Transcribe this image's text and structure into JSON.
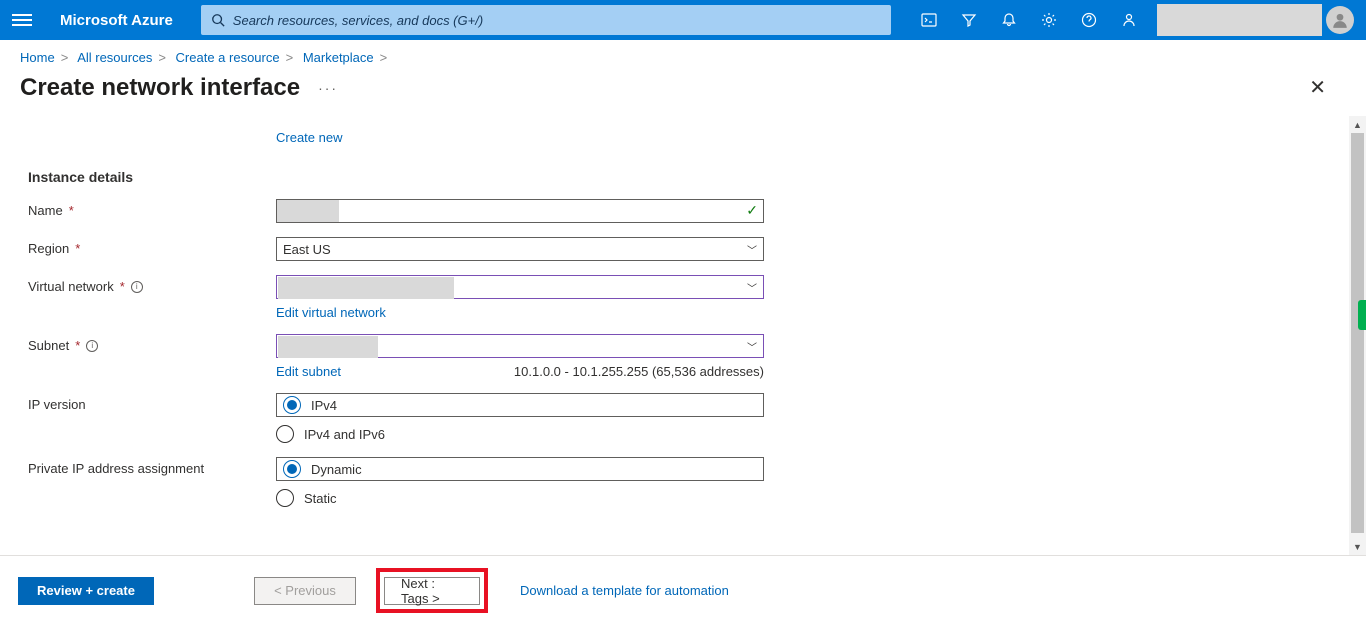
{
  "header": {
    "brand": "Microsoft Azure",
    "search_placeholder": "Search resources, services, and docs (G+/)"
  },
  "breadcrumb": {
    "items": [
      "Home",
      "All resources",
      "Create a resource",
      "Marketplace"
    ]
  },
  "page": {
    "title": "Create network interface"
  },
  "form": {
    "create_new": "Create new",
    "section_instance": "Instance details",
    "name_label": "Name",
    "name_value": "",
    "region_label": "Region",
    "region_value": "East US",
    "vnet_label": "Virtual network",
    "vnet_value": "",
    "vnet_edit": "Edit virtual network",
    "subnet_label": "Subnet",
    "subnet_value": "",
    "subnet_edit": "Edit subnet",
    "subnet_range": "10.1.0.0 - 10.1.255.255 (65,536 addresses)",
    "ipver_label": "IP version",
    "ipver_options": [
      "IPv4",
      "IPv4 and IPv6"
    ],
    "ipver_selected": 0,
    "pip_label": "Private IP address assignment",
    "pip_options": [
      "Dynamic",
      "Static"
    ],
    "pip_selected": 0
  },
  "footer": {
    "review": "Review + create",
    "prev": "< Previous",
    "next": "Next : Tags >",
    "download": "Download a template for automation"
  }
}
